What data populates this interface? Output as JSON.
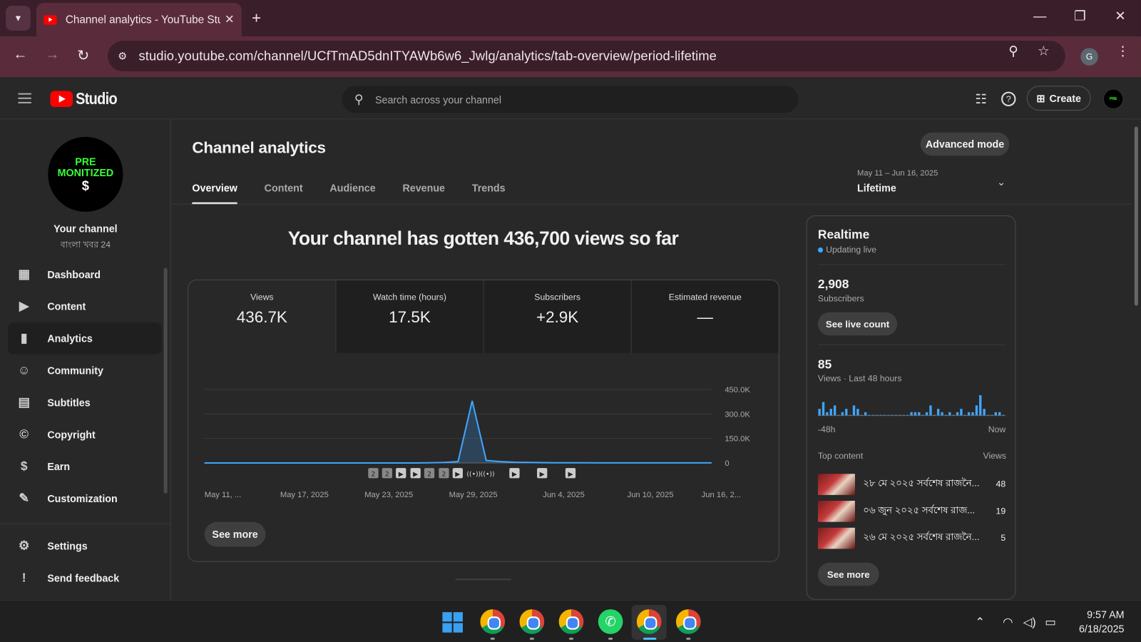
{
  "browser": {
    "tab_title": "Channel analytics - YouTube Studio",
    "url": "studio.youtube.com/channel/UCfTmAD5dnITYAWb6w6_Jwlg/analytics/tab-overview/period-lifetime",
    "profile_initial": "G"
  },
  "header": {
    "logo_text": "Studio",
    "search_placeholder": "Search across your channel",
    "create_label": "Create"
  },
  "sidebar": {
    "avatar_lines": [
      "PRE",
      "MONITIZED",
      "$"
    ],
    "channel_label": "Your channel",
    "channel_name": "বাংলা খবর 24",
    "items": [
      {
        "label": "Dashboard",
        "icon": "dashboard-icon"
      },
      {
        "label": "Content",
        "icon": "content-icon"
      },
      {
        "label": "Analytics",
        "icon": "analytics-icon"
      },
      {
        "label": "Community",
        "icon": "community-icon"
      },
      {
        "label": "Subtitles",
        "icon": "subtitles-icon"
      },
      {
        "label": "Copyright",
        "icon": "copyright-icon"
      },
      {
        "label": "Earn",
        "icon": "earn-icon"
      },
      {
        "label": "Customization",
        "icon": "customization-icon"
      }
    ],
    "bottom_items": [
      {
        "label": "Settings",
        "icon": "settings-icon"
      },
      {
        "label": "Send feedback",
        "icon": "feedback-icon"
      }
    ]
  },
  "main": {
    "title": "Channel analytics",
    "advanced_mode": "Advanced mode",
    "tabs": [
      "Overview",
      "Content",
      "Audience",
      "Revenue",
      "Trends"
    ],
    "active_tab": "Overview",
    "period_range": "May 11 – Jun 16, 2025",
    "period_value": "Lifetime",
    "headline": "Your channel has gotten 436,700 views so far",
    "metrics": [
      {
        "label": "Views",
        "value": "436.7K"
      },
      {
        "label": "Watch time (hours)",
        "value": "17.5K"
      },
      {
        "label": "Subscribers",
        "value": "+2.9K"
      },
      {
        "label": "Estimated revenue",
        "value": "—"
      }
    ],
    "see_more": "See more"
  },
  "chart_data": {
    "type": "line",
    "x_labels": [
      "May 11, ...",
      "May 17, 2025",
      "May 23, 2025",
      "May 29, 2025",
      "Jun 4, 2025",
      "Jun 10, 2025",
      "Jun 16, 2..."
    ],
    "y_ticks": [
      "450.0K",
      "300.0K",
      "150.0K",
      "0"
    ],
    "ylim": [
      0,
      450000
    ],
    "grid": true,
    "series": [
      {
        "color": "#3ea6ff",
        "x": [
          "May 11",
          "May 12",
          "May 13",
          "May 14",
          "May 15",
          "May 16",
          "May 17",
          "May 18",
          "May 19",
          "May 20",
          "May 21",
          "May 22",
          "May 23",
          "May 24",
          "May 25",
          "May 26",
          "May 27",
          "May 28",
          "May 29",
          "May 30",
          "May 31",
          "Jun 1",
          "Jun 2",
          "Jun 3",
          "Jun 4",
          "Jun 5",
          "Jun 6",
          "Jun 7",
          "Jun 8",
          "Jun 9",
          "Jun 10",
          "Jun 11",
          "Jun 12",
          "Jun 13",
          "Jun 14",
          "Jun 15",
          "Jun 16"
        ],
        "values": [
          0,
          0,
          0,
          0,
          0,
          0,
          0,
          0,
          0,
          0,
          0,
          0,
          0,
          0,
          0,
          0,
          1000,
          3000,
          8000,
          380000,
          15000,
          8000,
          4000,
          3000,
          2000,
          1000,
          1000,
          1000,
          500,
          500,
          500,
          500,
          500,
          500,
          500,
          500,
          500
        ]
      }
    ],
    "markers": [
      "2",
      "2",
      "▶",
      "▶",
      "2",
      "2",
      "▶",
      "((•))",
      "((•))",
      "▶",
      "▶",
      "▶"
    ]
  },
  "realtime": {
    "title": "Realtime",
    "live_label": "Updating live",
    "subscribers_value": "2,908",
    "subscribers_label": "Subscribers",
    "live_count_button": "See live count",
    "views_value": "85",
    "views_label": "Views · Last 48 hours",
    "axis_start": "-48h",
    "axis_end": "Now",
    "hourly_views": [
      2,
      4,
      1,
      2,
      3,
      0,
      1,
      2,
      0,
      3,
      2,
      0,
      1,
      0,
      0,
      0,
      0,
      0,
      0,
      0,
      0,
      0,
      0,
      0,
      1,
      1,
      1,
      0,
      1,
      3,
      0,
      2,
      1,
      0,
      1,
      0,
      1,
      2,
      0,
      1,
      1,
      3,
      6,
      2,
      0,
      0,
      1,
      1,
      0
    ],
    "top_content_label": "Top content",
    "views_col_label": "Views",
    "top_content": [
      {
        "title": "২৮ মে ২০২৫ সর্বশেষ রাজনৈ...",
        "views": "48"
      },
      {
        "title": "০৬ জুন ২০২৫ সর্বশেষ রাজ...",
        "views": "19"
      },
      {
        "title": "২৬ মে ২০২৫ সর্বশেষ রাজনৈ...",
        "views": "5"
      }
    ],
    "see_more": "See more"
  },
  "taskbar": {
    "time": "9:57 AM",
    "date": "6/18/2025"
  }
}
